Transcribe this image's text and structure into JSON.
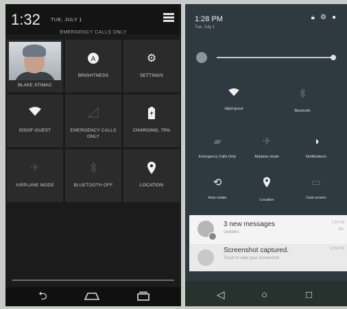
{
  "left": {
    "time": "1:32",
    "date": "TUE, JULY 1",
    "emergency": "EMERGENCY CALLS ONLY",
    "tiles": [
      {
        "label": "BLAKE STIMAC",
        "icon": "user-avatar"
      },
      {
        "label": "BRIGHTNESS",
        "icon": "brightness-auto-icon"
      },
      {
        "label": "SETTINGS",
        "icon": "gear-icon"
      },
      {
        "label": "IDGSF-GUEST",
        "icon": "wifi-icon"
      },
      {
        "label": "EMERGENCY CALLS ONLY",
        "icon": "signal-icon"
      },
      {
        "label": "CHARGING, 75%",
        "icon": "battery-charging-icon"
      },
      {
        "label": "AIRPLANE MODE",
        "icon": "airplane-icon"
      },
      {
        "label": "BLUETOOTH OFF",
        "icon": "bluetooth-icon"
      },
      {
        "label": "LOCATION",
        "icon": "location-pin-icon"
      }
    ]
  },
  "right": {
    "time": "1:28 PM",
    "date": "Tue, July 1",
    "tiles": [
      {
        "label": "idgsf-guest",
        "icon": "wifi-icon"
      },
      {
        "label": "Bluetooth",
        "icon": "bluetooth-icon"
      },
      {
        "label": "Emergency Calls Only",
        "icon": "sim-icon"
      },
      {
        "label": "Airplane mode",
        "icon": "airplane-icon"
      },
      {
        "label": "Notifications",
        "icon": "notifications-icon"
      },
      {
        "label": "Auto-rotate",
        "icon": "auto-rotate-icon"
      },
      {
        "label": "Location",
        "icon": "location-pin-icon"
      },
      {
        "label": "Cast screen",
        "icon": "cast-icon"
      }
    ],
    "notifications": [
      {
        "title": "3 new messages",
        "subtitle": "Updates",
        "time": "1:20 PM",
        "extra": "99+"
      },
      {
        "title": "Screenshot captured.",
        "subtitle": "Touch to view your screenshot.",
        "time": "12:56 PM"
      }
    ]
  },
  "colors": {
    "left_bg": "#1b1b1b",
    "tile_bg": "#2b2b2b",
    "right_bg": "#2f3a40",
    "notification_bg": "#f4f4f4"
  }
}
